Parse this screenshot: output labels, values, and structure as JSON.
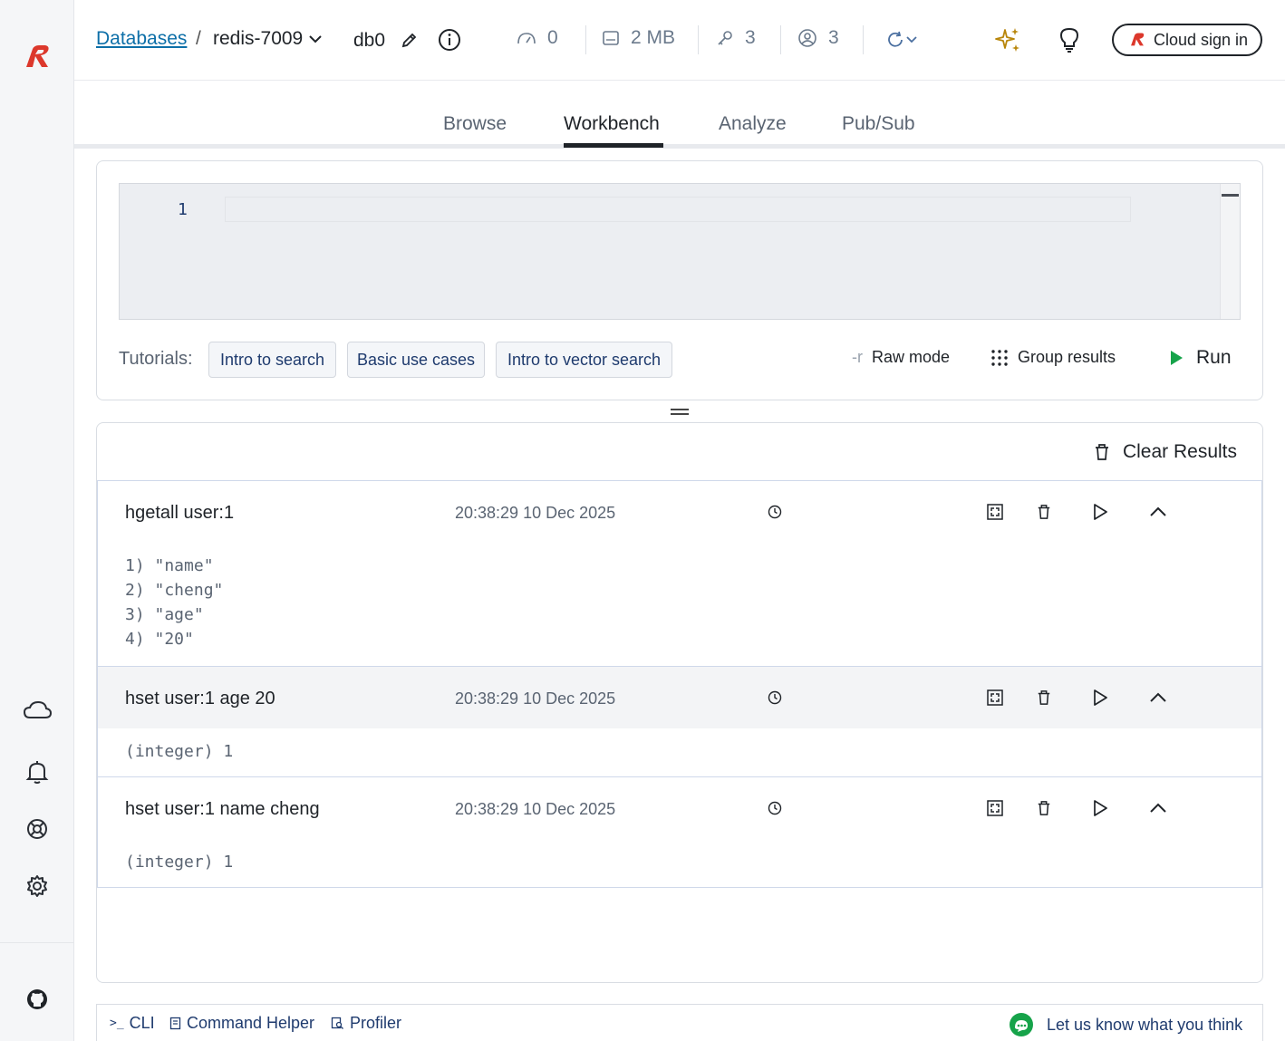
{
  "header": {
    "breadcrumb_root": "Databases",
    "breadcrumb_sep": "/",
    "database_name": "redis-7009",
    "db_index": "db0",
    "stats": {
      "ops_per_sec": "0",
      "memory": "2 MB",
      "keys": "3",
      "clients": "3"
    },
    "cloud_signin_label": "Cloud sign in"
  },
  "tabs": [
    "Browse",
    "Workbench",
    "Analyze",
    "Pub/Sub"
  ],
  "active_tab": "Workbench",
  "editor": {
    "line_number": "1",
    "content": ""
  },
  "tutorials": {
    "label": "Tutorials:",
    "buttons": [
      "Intro to search",
      "Basic use cases",
      "Intro to vector search"
    ]
  },
  "toolbar": {
    "raw_mode_label": "Raw mode",
    "group_results_label": "Group results",
    "run_label": "Run"
  },
  "results": {
    "clear_label": "Clear Results",
    "items": [
      {
        "command": "hgetall user:1",
        "timestamp": "20:38:29 10 Dec 2025",
        "output": [
          "1) \"name\"",
          "2) \"cheng\"",
          "3) \"age\"",
          "4) \"20\""
        ]
      },
      {
        "command": "hset user:1 age 20",
        "timestamp": "20:38:29 10 Dec 2025",
        "output": [
          "(integer) 1"
        ]
      },
      {
        "command": "hset user:1 name cheng",
        "timestamp": "20:38:29 10 Dec 2025",
        "output": [
          "(integer) 1"
        ]
      }
    ]
  },
  "bottom_bar": {
    "cli_label": "CLI",
    "command_helper_label": "Command Helper",
    "profiler_label": "Profiler",
    "feedback_label": "Let us know what you think"
  },
  "colors": {
    "brand_red": "#dc382c",
    "link_blue": "#0d6fa8",
    "run_green": "#16a34a",
    "sparkle_gold": "#b8860b"
  }
}
